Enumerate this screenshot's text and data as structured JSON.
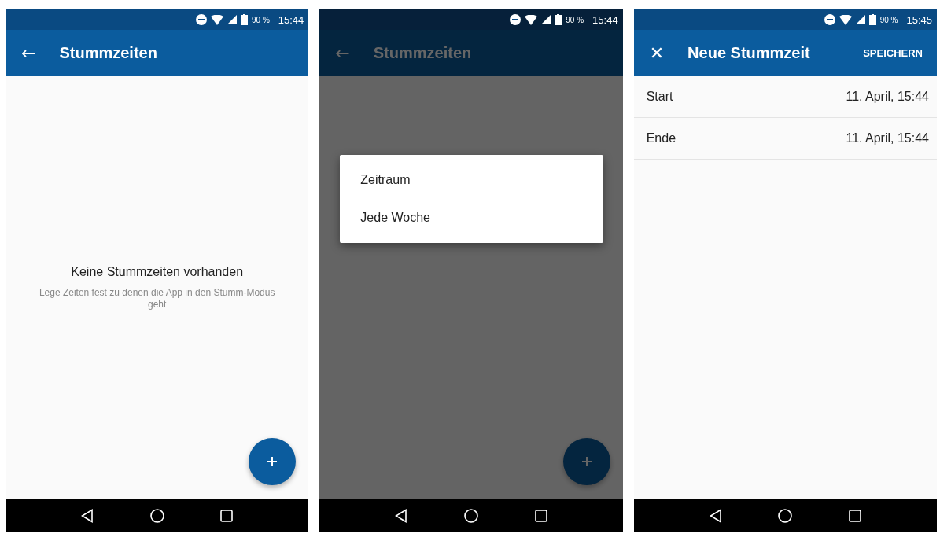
{
  "screens": [
    {
      "status_bar": {
        "battery": "90 %",
        "time": "15:44"
      },
      "app_bar": {
        "nav_icon": "←",
        "title": "Stummzeiten"
      },
      "dimmed": false,
      "fab": true,
      "body": {
        "kind": "empty",
        "title": "Keine Stummzeiten vorhanden",
        "message": "Lege Zeiten fest zu denen die App in den Stumm-Modus geht"
      }
    },
    {
      "status_bar": {
        "battery": "90 %",
        "time": "15:44"
      },
      "app_bar": {
        "nav_icon": "←",
        "title": "Stummzeiten"
      },
      "dimmed": true,
      "fab": true,
      "body": {
        "kind": "menu",
        "items": [
          "Zeitraum",
          "Jede Woche"
        ]
      }
    },
    {
      "status_bar": {
        "battery": "90 %",
        "time": "15:45"
      },
      "app_bar": {
        "nav_icon": "✕",
        "title": "Neue Stummzeit",
        "action": "SPEICHERN"
      },
      "dimmed": false,
      "fab": false,
      "body": {
        "kind": "form",
        "rows": [
          {
            "label": "Start",
            "value": "11. April, 15:44"
          },
          {
            "label": "Ende",
            "value": "11. April, 15:44"
          }
        ]
      }
    }
  ]
}
